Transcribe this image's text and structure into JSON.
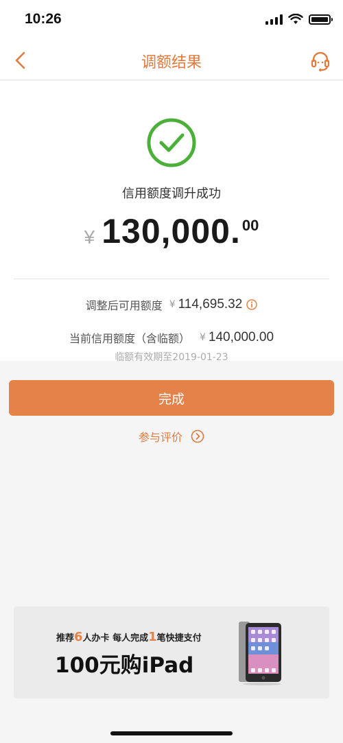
{
  "status_bar": {
    "time": "10:26"
  },
  "nav": {
    "title": "调额结果"
  },
  "result": {
    "message": "信用额度调升成功",
    "currency": "¥",
    "amount_int": "130,000.",
    "amount_dec": "00"
  },
  "details": {
    "available_label": "调整后可用额度",
    "available_currency": "¥",
    "available_value": "114,695.32",
    "current_label": "当前信用额度（含临额）",
    "current_currency": "¥",
    "current_value": "140,000.00",
    "expiry": "临额有效期至2019-01-23"
  },
  "actions": {
    "done_label": "完成",
    "feedback_label": "参与评价"
  },
  "promo": {
    "line1_a": "推荐",
    "line1_num1": "6",
    "line1_b": "人办卡 每人完成",
    "line1_num2": "1",
    "line1_c": "笔快捷支付",
    "line2": "100元购iPad"
  },
  "colors": {
    "accent": "#e5824a",
    "success": "#4caf3a"
  },
  "icons": {
    "back": "chevron-left-icon",
    "service": "headset-icon",
    "success": "check-circle-icon",
    "info": "info-icon",
    "arrow": "arrow-right-circle-icon"
  }
}
